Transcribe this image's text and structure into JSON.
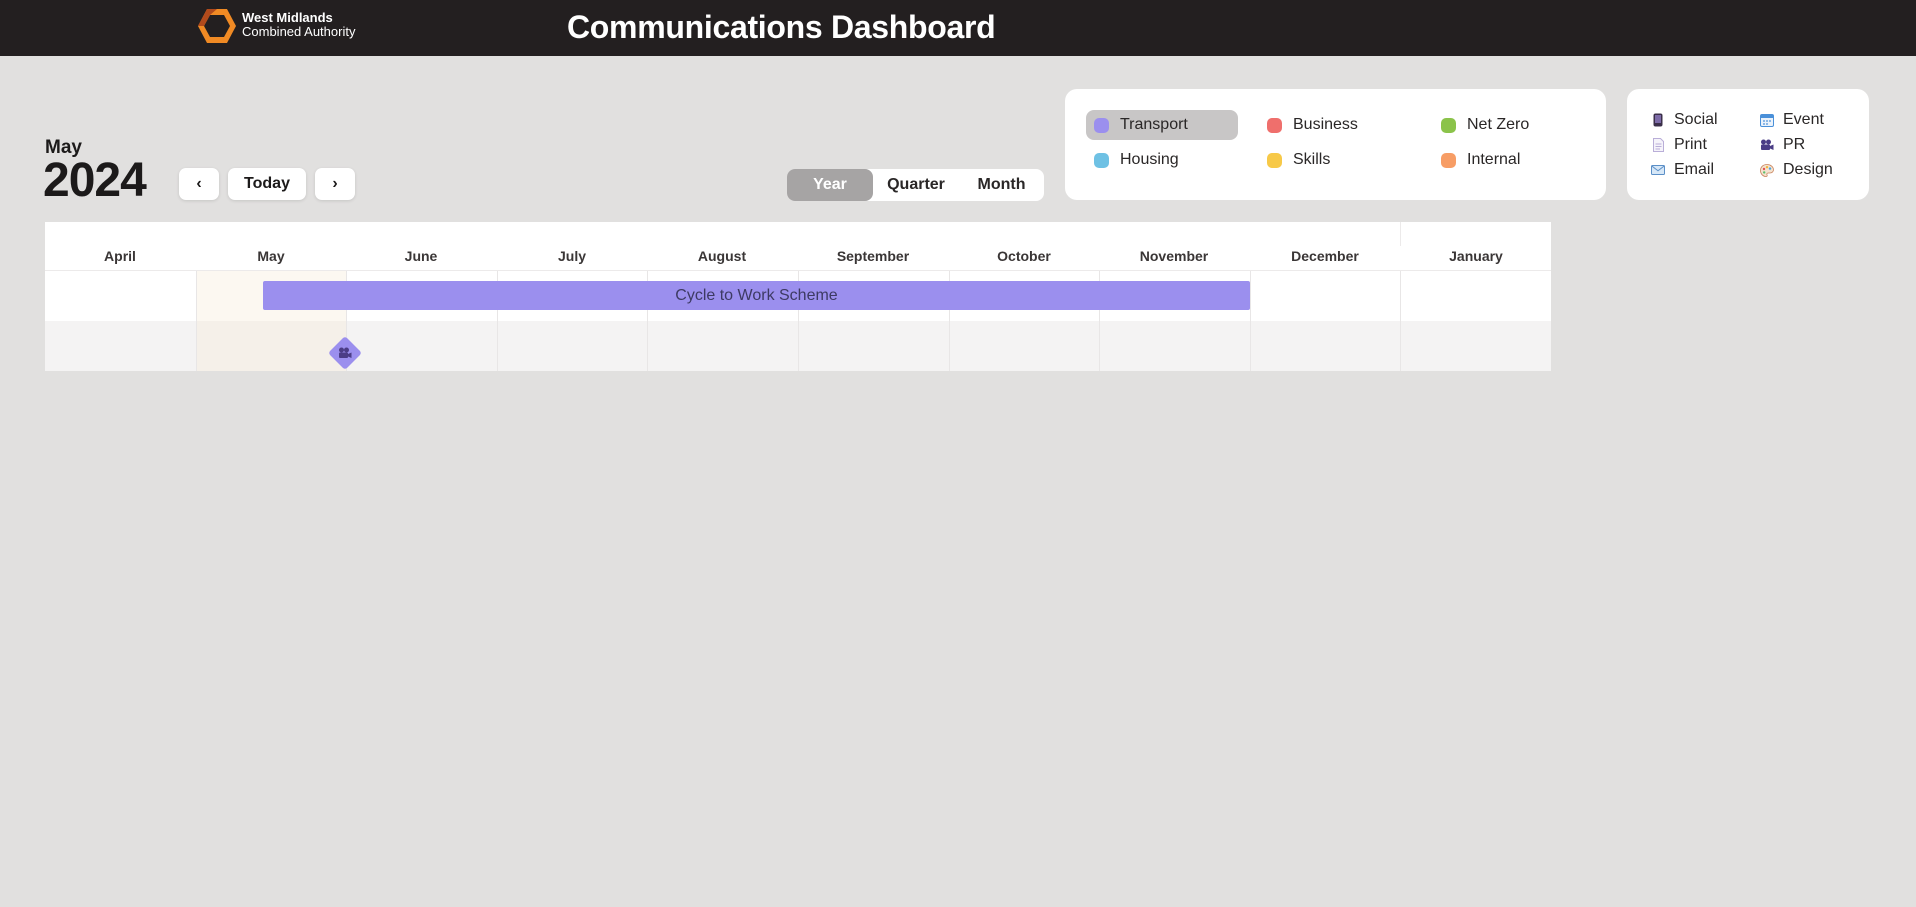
{
  "header": {
    "org_line1": "West Midlands",
    "org_line2": "Combined Authority",
    "title": "Communications Dashboard",
    "background": "#231f20",
    "logo_colors": [
      "#f08a24",
      "#b14a1c"
    ]
  },
  "date_display": {
    "month": "May",
    "year": "2024"
  },
  "nav": {
    "prev_label": "‹",
    "today_label": "Today",
    "next_label": "›"
  },
  "view_toggle": {
    "options": [
      "Year",
      "Quarter",
      "Month"
    ],
    "selected": "Year"
  },
  "legend": {
    "categories": [
      {
        "label": "Transport",
        "color": "#9b8fee",
        "active": true
      },
      {
        "label": "Business",
        "color": "#ef6f6c",
        "active": false
      },
      {
        "label": "Net Zero",
        "color": "#8bc34a",
        "active": false
      },
      {
        "label": "Housing",
        "color": "#6ec1e4",
        "active": false
      },
      {
        "label": "Skills",
        "color": "#f7c948",
        "active": false
      },
      {
        "label": "Internal",
        "color": "#f79d65",
        "active": false
      }
    ]
  },
  "types": [
    {
      "label": "Social",
      "icon": "phone-icon"
    },
    {
      "label": "Event",
      "icon": "calendar-icon"
    },
    {
      "label": "Print",
      "icon": "document-icon"
    },
    {
      "label": "PR",
      "icon": "camera-icon"
    },
    {
      "label": "Email",
      "icon": "envelope-icon"
    },
    {
      "label": "Design",
      "icon": "palette-icon"
    }
  ],
  "timeline": {
    "months": [
      "April",
      "May",
      "June",
      "July",
      "August",
      "September",
      "October",
      "November",
      "December",
      "January"
    ],
    "current_month": "May",
    "events": [
      {
        "label": "Cycle to Work Scheme",
        "category": "Transport",
        "start": "2024-05-15",
        "end": "2024-11-30"
      }
    ],
    "milestones": [
      {
        "category": "Transport",
        "type": "PR",
        "date": "2024-05-31",
        "icon": "camera-icon"
      }
    ]
  }
}
